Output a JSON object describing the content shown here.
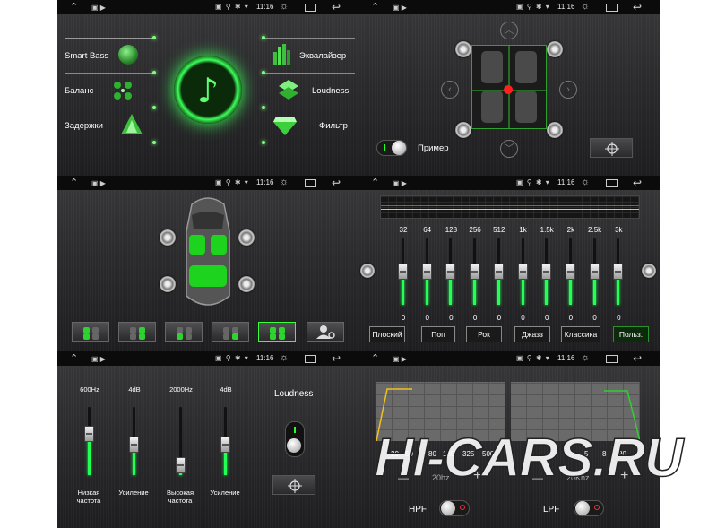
{
  "status_bar": {
    "time": "11:16"
  },
  "panel1": {
    "left_items": [
      "Smart Bass",
      "Баланс",
      "Задержки"
    ],
    "right_items": [
      "Эквалайзер",
      "Loudness",
      "Фильтр"
    ],
    "center_icon": "music-note-icon",
    "accent": "#3cff5a"
  },
  "panel2": {
    "example_label": "Пример"
  },
  "panel3": {
    "seat_modes": 6,
    "active_mode": 4
  },
  "panel4": {
    "bands": [
      "32",
      "64",
      "128",
      "256",
      "512",
      "1k",
      "1.5k",
      "2k",
      "2.5k",
      "3k"
    ],
    "values": [
      "0",
      "0",
      "0",
      "0",
      "0",
      "0",
      "0",
      "0",
      "0",
      "0"
    ],
    "presets": [
      "Плоский",
      "Поп",
      "Рок",
      "Джазз",
      "Классика",
      "Польз."
    ],
    "active_preset": "Польз."
  },
  "panel5": {
    "columns": [
      {
        "top": "600Hz",
        "bottom": "Низкая частота",
        "level": 0.6
      },
      {
        "top": "4dB",
        "bottom": "Усиление",
        "level": 0.45
      },
      {
        "top": "2000Hz",
        "bottom": "Высокая частота",
        "level": 0.15
      },
      {
        "top": "4dB",
        "bottom": "Усиление",
        "level": 0.45
      }
    ],
    "loudness_label": "Loudness"
  },
  "panel6": {
    "hpf_ticks": [
      "20",
      "50",
      "80",
      "180",
      "325",
      "500"
    ],
    "lpf_ticks": [
      "5",
      "8",
      "20"
    ],
    "hpf_value": "20hz",
    "lpf_value": "20Khz",
    "hpf_label": "HPF",
    "lpf_label": "LPF",
    "minus": "—",
    "plus": "+"
  },
  "watermark": "HI-CARS.RU"
}
